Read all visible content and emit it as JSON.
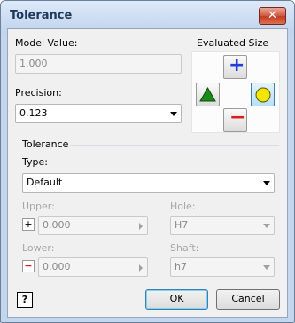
{
  "window": {
    "title": "Tolerance",
    "close_glyph": "✕"
  },
  "model_value": {
    "label": "Model Value:",
    "value": "1.000"
  },
  "precision": {
    "label": "Precision:",
    "value": "0.123"
  },
  "evaluated_size": {
    "label": "Evaluated Size",
    "buttons": [
      {
        "name": "upper-icon",
        "glyph": "+",
        "color": "#1f3fd6"
      },
      {
        "name": "nominal-icon",
        "color": "#1a8a1a"
      },
      {
        "name": "median-icon",
        "color": "#f2e600"
      },
      {
        "name": "lower-icon",
        "glyph": "−",
        "color": "#d92020"
      }
    ]
  },
  "tolerance": {
    "group_label": "Tolerance",
    "type_label": "Type:",
    "type_value": "Default",
    "upper_label": "Upper:",
    "upper_value": "0.000",
    "upper_sign": "+",
    "lower_label": "Lower:",
    "lower_value": "0.000",
    "lower_sign": "−",
    "hole_label": "Hole:",
    "hole_value": "H7",
    "shaft_label": "Shaft:",
    "shaft_value": "h7"
  },
  "footer": {
    "help_glyph": "?",
    "ok_label": "OK",
    "cancel_label": "Cancel"
  }
}
